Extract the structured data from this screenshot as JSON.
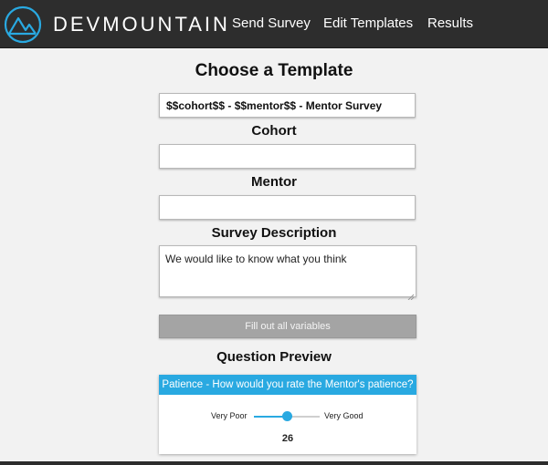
{
  "brand": {
    "name": "DEVMOUNTAIN",
    "logo_icon": "mountain-logo-icon"
  },
  "nav": {
    "items": [
      "Send Survey",
      "Edit Templates",
      "Results"
    ]
  },
  "page": {
    "title": "Choose a Template"
  },
  "form": {
    "template_value": "$$cohort$$ - $$mentor$$ - Mentor Survey",
    "cohort_label": "Cohort",
    "cohort_value": "",
    "mentor_label": "Mentor",
    "mentor_value": "",
    "description_label": "Survey Description",
    "description_value": "We would like to know what you think",
    "submit_label": "Fill out all variables"
  },
  "preview": {
    "title": "Question Preview",
    "question": "Patience - How would you rate the Mentor's patience?",
    "scale_min_label": "Very Poor",
    "scale_max_label": "Very Good",
    "value": 26,
    "value_fraction": 0.5
  },
  "colors": {
    "navbar": "#2d2d2d",
    "accent": "#29a9e1",
    "disabled_button": "#a4a4a4"
  }
}
